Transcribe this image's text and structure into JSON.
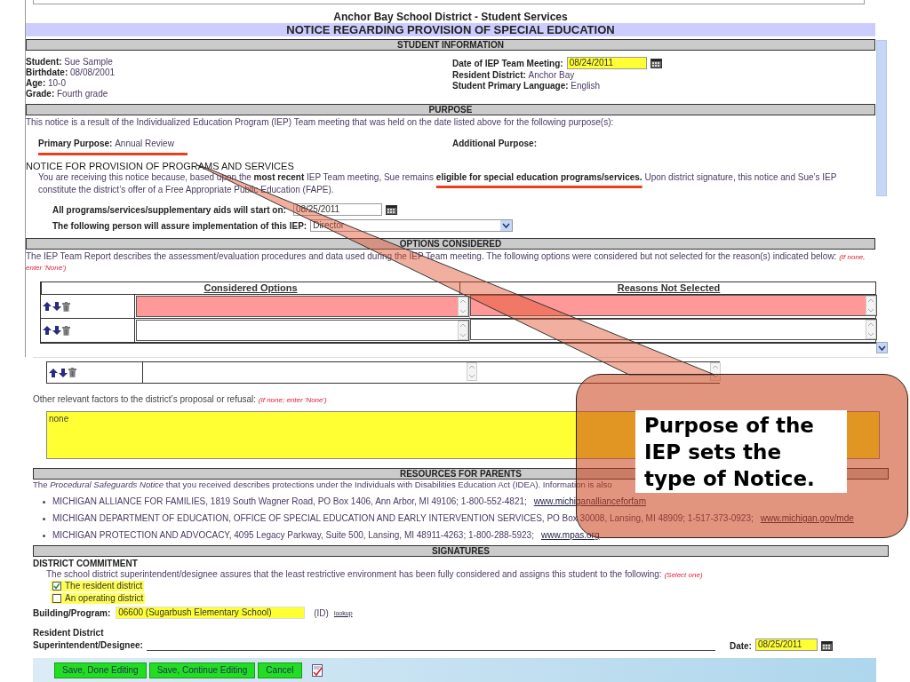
{
  "form_header": {
    "title": "Anchor Bay School District - Student Services",
    "notice_title": "NOTICE REGARDING PROVISION OF SPECIAL EDUCATION"
  },
  "student_information": {
    "heading": "STUDENT INFORMATION",
    "left": [
      {
        "label": "Student:",
        "value": "Sue Sample"
      },
      {
        "label": "Birthdate:",
        "value": "08/08/2001"
      },
      {
        "label": "Age:",
        "value": "10-0"
      },
      {
        "label": "Grade:",
        "value": "Fourth grade"
      }
    ],
    "right": [
      {
        "kind": "date",
        "label": "Date of IEP Team Meeting:",
        "value": "08/24/2011"
      },
      {
        "kind": "text",
        "label": "Resident District:",
        "value": "Anchor Bay"
      },
      {
        "kind": "text",
        "label": "Student Primary Language:",
        "value": "English"
      }
    ]
  },
  "purpose": {
    "heading": "PURPOSE",
    "intro": "This notice is a result of the Individualized Education Program (IEP) Team meeting that was held on the date listed above for the following purpose(s):",
    "primary_label": "Primary Purpose:",
    "primary_value": "Annual Review",
    "additional_label": "Additional Purpose:",
    "notice_heading": "NOTICE FOR PROVISION OF PROGRAMS AND SERVICES",
    "notice_text": "You are receiving this notice because, based upon the **most recent** IEP Team meeting, Sue remains **eligible for special education programs/services.** Upon district signature, this notice and Sue’s IEP constitute the district’s offer of a Free Appropriate Public Education (FAPE).",
    "start_label": "All programs/services/supplementary aids will start on:",
    "start_value": "08/25/2011",
    "person_label": "The following person will assure implementation of this IEP:",
    "person_value": "Director"
  },
  "options_considered": {
    "heading": "OPTIONS CONSIDERED",
    "intro": "The IEP Team Report describes the assessment/evaluation procedures and data used during the IEP Team meeting. The following options were considered but not selected for the reason(s) indicated below:",
    "hint": "(If none, enter 'None')",
    "columns": [
      "Considered Options",
      "Reasons Not Selected"
    ],
    "rows": [
      {
        "invalid": true
      },
      {
        "invalid": false
      },
      {
        "invalid": false
      }
    ]
  },
  "other_factors": {
    "label": "Other relevant factors to the district’s proposal or refusal:",
    "hint": "(If none; enter 'None')",
    "value": "none"
  },
  "resources": {
    "heading": "RESOURCES FOR PARENTS",
    "intro": "The *Procedural Safeguards Notice* that you received describes protections under the Individuals with Disabilities Education Act (IDEA). Information is also",
    "items": [
      {
        "text": "MICHIGAN ALLIANCE FOR FAMILIES, 1819 South Wagner Road, PO Box 1406, Ann Arbor, MI 49106; 1-800-552-4821;",
        "link": "www.michiganallianceforfam"
      },
      {
        "text": "MICHIGAN DEPARTMENT OF EDUCATION, OFFICE OF SPECIAL EDUCATION AND EARLY INTERVENTION SERVICES, PO Box 30008, Lansing, MI 48909; 1-517-373-0923;",
        "link": "www.michigan.gov/mde"
      },
      {
        "text": "MICHIGAN PROTECTION AND ADVOCACY, 4095 Legacy Parkway, Suite 500, Lansing, MI 48911-4263; 1-800-288-5923;",
        "link": "www.mpas.org"
      }
    ]
  },
  "signatures": {
    "heading": "SIGNATURES",
    "commitment_heading": "DISTRICT COMMITMENT",
    "commitment_text": "The school district superintendent/designee assures that the least restrictive environment has been fully considered and assigns this student to the following:",
    "hint": "(Select one)",
    "options": [
      {
        "label": "The resident district",
        "checked": true
      },
      {
        "label": "An operating district",
        "checked": false
      }
    ],
    "building_label": "Building/Program:",
    "building_value": "06600 (Sugarbush Elementary School)",
    "id_label": "(ID)",
    "lookup_link": "lookup",
    "signer_label_1": "Resident District",
    "signer_label_2": "Superintendent/Designee:",
    "date_label": "Date:",
    "date_value": "08/25/2011"
  },
  "buttons": [
    "Save, Done Editing",
    "Save, Continue Editing",
    "Cancel"
  ],
  "callout": {
    "text": "Purpose of the IEP sets the type of Notice."
  }
}
